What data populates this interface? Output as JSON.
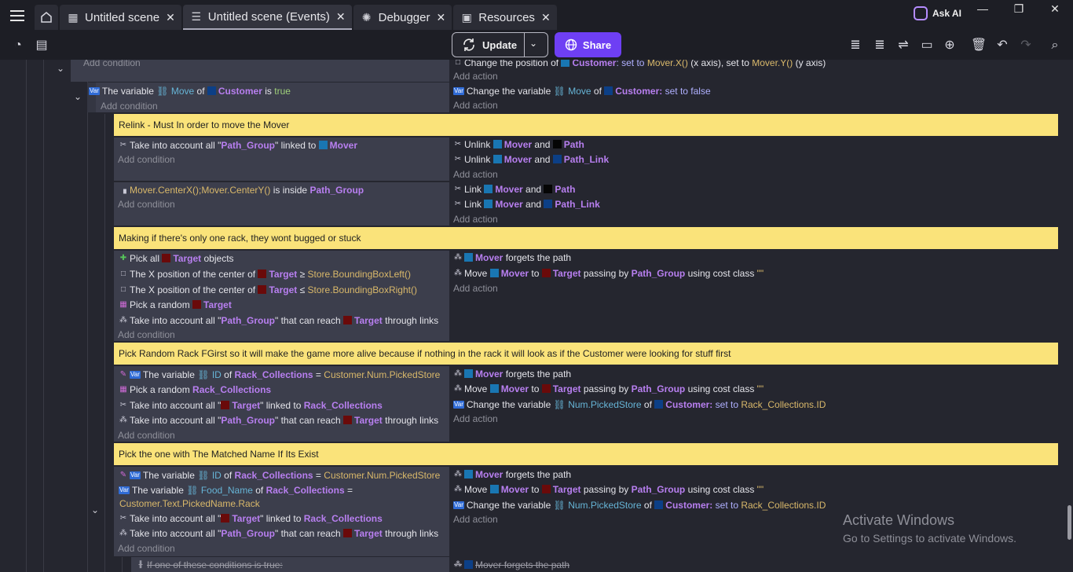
{
  "tabs": [
    {
      "label": "Untitled scene",
      "icon": "film-icon"
    },
    {
      "label": "Untitled scene (Events)",
      "icon": "events-icon"
    },
    {
      "label": "Debugger",
      "icon": "bug-icon"
    },
    {
      "label": "Resources",
      "icon": "resources-icon"
    }
  ],
  "ask_ai": "Ask AI",
  "toolbar": {
    "update": "Update",
    "share": "Share"
  },
  "common": {
    "add_condition": "Add condition",
    "add_action": "Add action"
  },
  "event0": {
    "cond_partial": "Add condition",
    "act_l1": "Change the position of",
    "act_obj": "Customer",
    "act_rest1": ": set to",
    "act_val1": "Mover.X()",
    "act_rest2": "(x axis), set to",
    "act_val2": "Mover.Y()",
    "act_rest3": "(y axis)"
  },
  "event1": {
    "cond": {
      "pre": "The variable",
      "var": "Move",
      "of": "of",
      "obj": "Customer",
      "is": "is",
      "val": "true"
    },
    "act": {
      "pre": "Change the variable",
      "var": "Move",
      "of": "of",
      "obj": "Customer",
      "colon": ":",
      "set": "set to false"
    }
  },
  "comment1": "Relink - Must In order to move the Mover",
  "event2": {
    "cond": {
      "pre": "Take into account all \"",
      "grp": "Path_Group",
      "mid": "\" linked to",
      "obj": "Mover"
    },
    "acts": [
      {
        "pre": "Unlink",
        "a": "Mover",
        "and": "and",
        "b": "Path"
      },
      {
        "pre": "Unlink",
        "a": "Mover",
        "and": "and",
        "b": "Path_Link"
      }
    ]
  },
  "event3": {
    "cond": {
      "val": "Mover.CenterX();Mover.CenterY()",
      "mid": "is inside",
      "grp": "Path_Group"
    },
    "acts": [
      {
        "pre": "Link",
        "a": "Mover",
        "and": "and",
        "b": "Path"
      },
      {
        "pre": "Link",
        "a": "Mover",
        "and": "and",
        "b": "Path_Link"
      }
    ]
  },
  "comment2": "Making if there's only one rack, they wont bugged or stuck",
  "event4": {
    "conds": [
      {
        "pre": "Pick all",
        "obj": "Target",
        "post": "objects"
      },
      {
        "pre": "The X position of the center of",
        "obj": "Target",
        "op": "≥",
        "val": "Store.BoundingBoxLeft()"
      },
      {
        "pre": "The X position of the center of",
        "obj": "Target",
        "op": "≤",
        "val": "Store.BoundingBoxRight()"
      },
      {
        "pre": "Pick a random",
        "obj": "Target"
      },
      {
        "pre": "Take into account all \"",
        "grp": "Path_Group",
        "mid": "\" that can reach",
        "obj": "Target",
        "post": "through links"
      }
    ],
    "acts": [
      {
        "obj": "Mover",
        "post": "forgets the path"
      },
      {
        "pre": "Move",
        "obj": "Mover",
        "to": "to",
        "tgt": "Target",
        "mid": "passing by",
        "grp": "Path_Group",
        "post": "using cost class",
        "q": "\"\""
      }
    ]
  },
  "comment3": "Pick Random Rack FGirst so it will make the game more alive because if nothing in the rack it will look as if the Customer were looking for stuff first",
  "event5": {
    "conds": [
      {
        "pre": "The variable",
        "var": "ID",
        "of": "of",
        "obj": "Rack_Collections",
        "op": "=",
        "val": "Customer.Num.PickedStore"
      },
      {
        "pre": "Pick a random",
        "obj": "Rack_Collections"
      },
      {
        "pre": "Take into account all \"",
        "grp": "Target",
        "mid": "\" linked to",
        "obj": "Rack_Collections"
      },
      {
        "pre": "Take into account all \"",
        "grp": "Path_Group",
        "mid": "\" that can reach",
        "obj": "Target",
        "post": "through links"
      }
    ],
    "acts": [
      {
        "obj": "Mover",
        "post": "forgets the path"
      },
      {
        "pre": "Move",
        "obj": "Mover",
        "to": "to",
        "tgt": "Target",
        "mid": "passing by",
        "grp": "Path_Group",
        "post": "using cost class",
        "q": "\"\""
      },
      {
        "pre": "Change the variable",
        "var": "Num.PickedStore",
        "of": "of",
        "obj": "Customer",
        "colon": ":",
        "set": "set to",
        "val": "Rack_Collections.ID"
      }
    ]
  },
  "comment4": "Pick the one with The Matched Name If Its Exist",
  "event6": {
    "conds": [
      {
        "pre": "The variable",
        "var": "ID",
        "of": "of",
        "obj": "Rack_Collections",
        "op": "=",
        "val": "Customer.Num.PickedStore"
      },
      {
        "pre": "The variable",
        "var": "Food_Name",
        "of": "of",
        "obj": "Rack_Collections",
        "op": "=",
        "val": "Customer.Text.PickedName.Rack"
      },
      {
        "pre": "Take into account all \"",
        "grp": "Target",
        "mid": "\" linked to",
        "obj": "Rack_Collections"
      },
      {
        "pre": "Take into account all \"",
        "grp": "Path_Group",
        "mid": "\" that can reach",
        "obj": "Target",
        "post": "through links"
      }
    ],
    "acts": [
      {
        "obj": "Mover",
        "post": "forgets the path"
      },
      {
        "pre": "Move",
        "obj": "Mover",
        "to": "to",
        "tgt": "Target",
        "mid": "passing by",
        "grp": "Path_Group",
        "post": "using cost class",
        "q": "\"\""
      },
      {
        "pre": "Change the variable",
        "var": "Num.PickedStore",
        "of": "of",
        "obj": "Customer",
        "colon": ":",
        "set": "set to",
        "val": "Rack_Collections.ID"
      }
    ]
  },
  "event7": {
    "cond": "If one of these conditions is true:",
    "act": {
      "obj": "Mover",
      "post": "forgets the path"
    }
  },
  "watermark": {
    "line1": "Activate Windows",
    "line2": "Go to Settings to activate Windows."
  }
}
